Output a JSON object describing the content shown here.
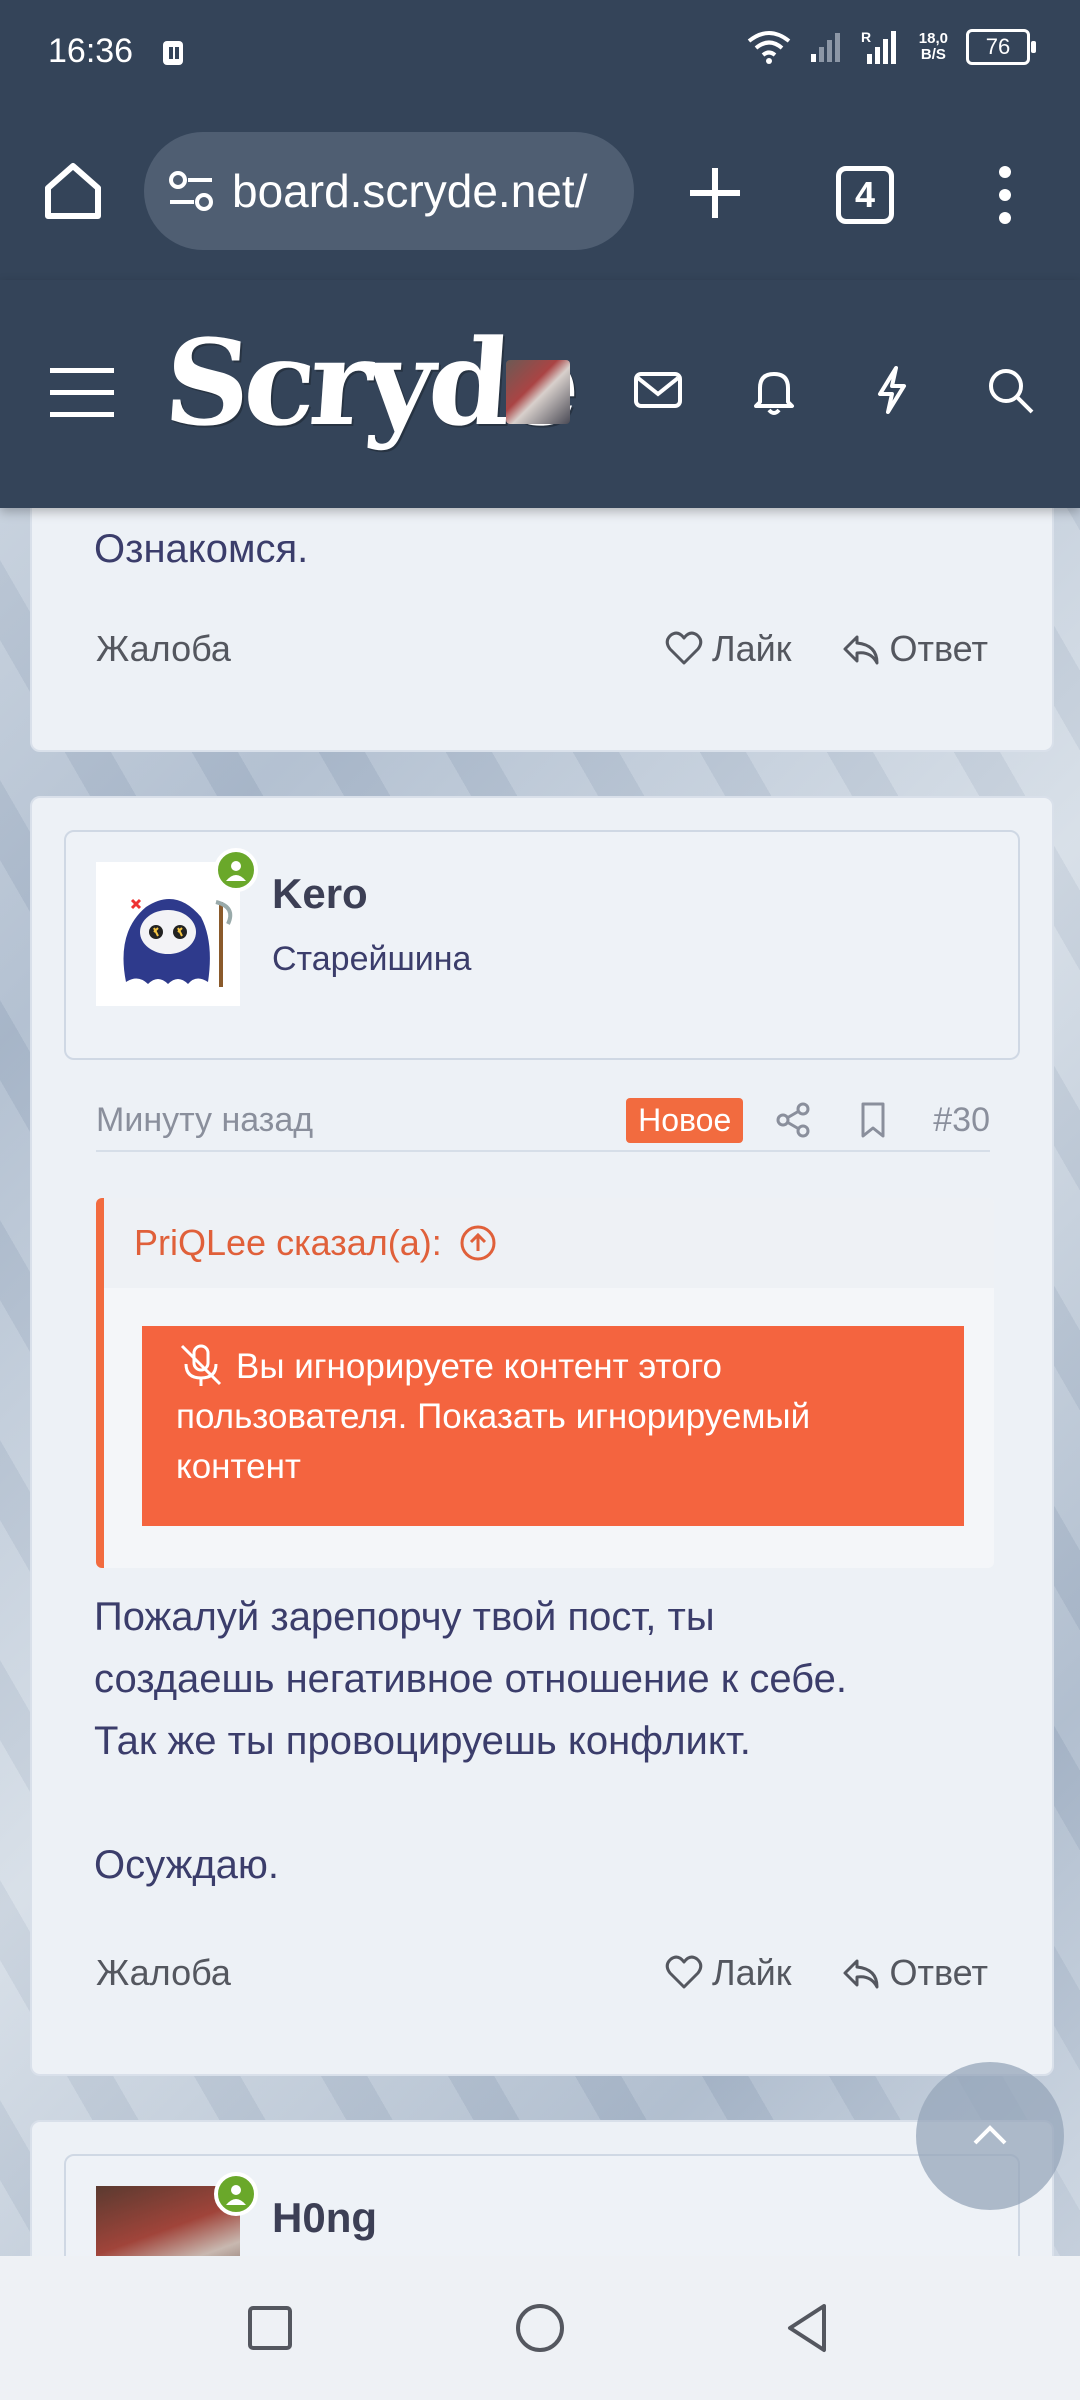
{
  "status_bar": {
    "time": "16:36",
    "net_speed_top": "18,0",
    "net_speed_bottom": "B/S",
    "battery": "76"
  },
  "browser": {
    "url": "board.scryde.net/",
    "tabs_count": "4"
  },
  "site": {
    "logo_text": "Scryde"
  },
  "prev_post": {
    "text": "Ознакомся.",
    "report_label": "Жалоба",
    "like_label": "Лайк",
    "reply_label": "Ответ"
  },
  "post": {
    "username": "Kero",
    "user_title": "Старейшина",
    "time": "Минуту назад",
    "new_badge": "Новое",
    "number": "#30",
    "quote_header": "PriQLee сказал(а):",
    "ignored_text": "Вы игнорируете контент этого пользователя. Показать игнорируемый контент",
    "body_lines": [
      "Пожалуй зарепорчу твой пост, ты",
      "создаешь негативное отношение к себе.",
      "Так же ты провоцируешь конфликт.",
      "",
      "Осуждаю."
    ],
    "report_label": "Жалоба",
    "like_label": "Лайк",
    "reply_label": "Ответ"
  },
  "next_post": {
    "username": "H0ng"
  },
  "colors": {
    "header_bg": "#344459",
    "accent": "#f26b3f",
    "online": "#6aa82a",
    "text": "#3b3d6b"
  },
  "icons": [
    "home-icon",
    "tune-icon",
    "plus-icon",
    "tabs-icon",
    "more-vert-icon",
    "hamburger-icon",
    "mail-icon",
    "bell-icon",
    "bolt-icon",
    "search-icon",
    "heart-icon",
    "reply-icon",
    "share-icon",
    "bookmark-icon",
    "arrow-up-circle-icon",
    "mic-off-icon",
    "chevron-up-icon",
    "square-icon",
    "circle-icon",
    "back-triangle-icon"
  ]
}
